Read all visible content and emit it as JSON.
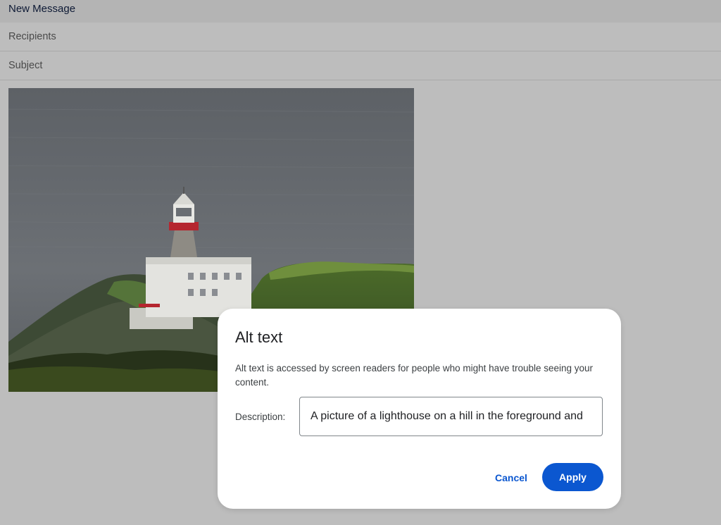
{
  "compose": {
    "title": "New Message",
    "recipients_label": "Recipients",
    "subject_label": "Subject"
  },
  "image": {
    "subject": "lighthouse-on-hill-photo"
  },
  "dialog": {
    "title": "Alt text",
    "description": "Alt text is accessed by screen readers for people who might have trouble seeing your content.",
    "field_label": "Description:",
    "field_value": "A picture of a lighthouse on a hill in the foreground and",
    "cancel_label": "Cancel",
    "apply_label": "Apply"
  },
  "colors": {
    "accent": "#0b57d0",
    "overlay": "#bdbdbd",
    "dialog_bg": "#ffffff"
  }
}
